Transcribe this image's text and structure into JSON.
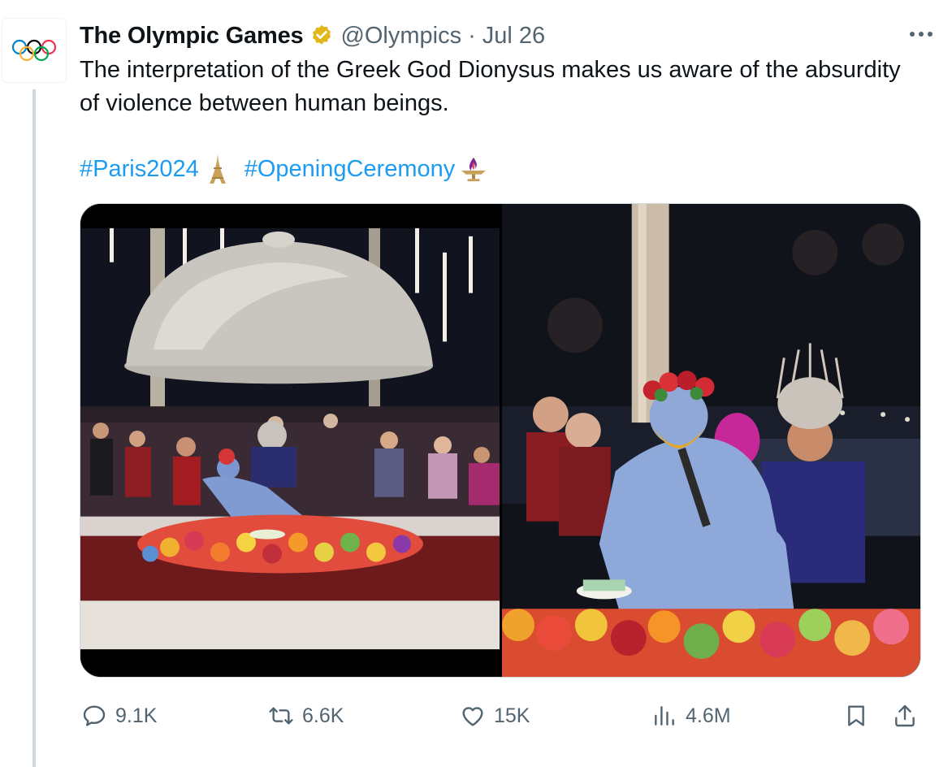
{
  "tweet": {
    "author_name": "The Olympic Games",
    "handle": "@Olympics",
    "separator": "·",
    "date": "Jul 26",
    "text": "The interpretation of the Greek God Dionysus makes us aware of the absurdity of violence between human beings.",
    "hashtags": [
      "#Paris2024",
      "#OpeningCeremony"
    ]
  },
  "stats": {
    "replies": "9.1K",
    "retweets": "6.6K",
    "likes": "15K",
    "views": "4.6M"
  },
  "colors": {
    "accent": "#1d9bf0",
    "secondary_text": "#536471",
    "verified_gold": "#e2b719"
  },
  "icons": {
    "avatar": "olympic-rings-icon",
    "verified": "verified-badge-icon",
    "more": "more-options-icon",
    "reply": "reply-icon",
    "retweet": "retweet-icon",
    "like": "heart-icon",
    "views": "views-chart-icon",
    "bookmark": "bookmark-icon",
    "share": "share-icon"
  }
}
